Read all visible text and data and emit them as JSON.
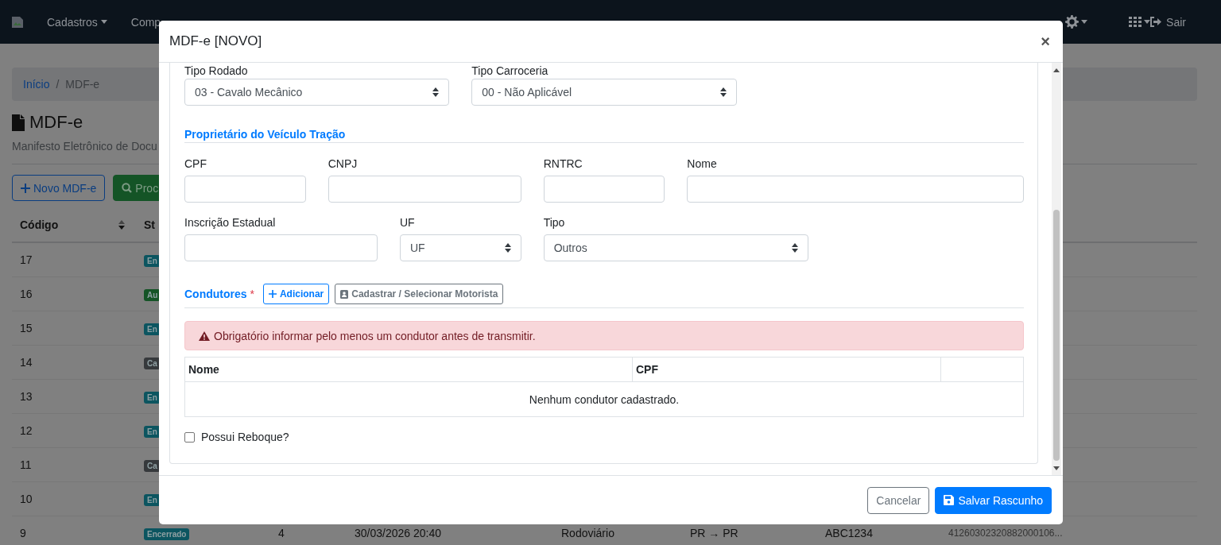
{
  "navbar": {
    "menu": [
      {
        "label": "Cadastros",
        "dropdown": true
      },
      {
        "label": "Comp",
        "dropdown": false
      }
    ],
    "logout": "Sair"
  },
  "breadcrumb": {
    "separator": "/",
    "items": [
      {
        "label": "Início",
        "kind": "link"
      },
      {
        "label": "MDF-e",
        "kind": "current"
      }
    ]
  },
  "page": {
    "title": "MDF-e",
    "subtitle": "Manifesto Eletrônico de Docu"
  },
  "actions": [
    {
      "label": "Novo MDF-e",
      "kind": "new"
    },
    {
      "label": "Proc",
      "kind": "search"
    }
  ],
  "table": {
    "columns": [
      "Código",
      "St"
    ],
    "rows": [
      {
        "code": "17",
        "status": {
          "label": "En",
          "color": "#0c5560"
        }
      },
      {
        "code": "16",
        "status": {
          "label": "Au",
          "color": "#145426"
        }
      },
      {
        "code": "15",
        "status": {
          "label": "En",
          "color": "#0c5560"
        }
      },
      {
        "code": "14",
        "status": {
          "label": "Ca",
          "color": "#36393c"
        }
      },
      {
        "code": "13",
        "status": {
          "label": "En",
          "color": "#0c5560"
        }
      },
      {
        "code": "12",
        "status": {
          "label": "En",
          "color": "#0c5560"
        }
      },
      {
        "code": "11",
        "status": {
          "label": "Ca",
          "color": "#36393c"
        }
      },
      {
        "code": "10",
        "status": {
          "label": "En",
          "color": "#0c5560"
        }
      },
      {
        "code": "9",
        "status": {
          "label": "Encerrado",
          "color": "#0c5560"
        },
        "cells": [
          "4",
          "30/03/2026 20:40",
          "Rodoviário",
          "PR → PR",
          "ABC1234",
          "41260302320882000106..."
        ]
      }
    ]
  },
  "modal": {
    "title": "MDF-e [NOVO]",
    "close": "×",
    "vehicle_fields": [
      {
        "kind": "select",
        "label": "Tipo Rodado",
        "value": "03 - Cavalo Mecânico"
      },
      {
        "kind": "select",
        "label": "Tipo Carroceria",
        "value": "00 - Não Aplicável"
      }
    ],
    "owner": {
      "heading": "Proprietário do Veículo Tração",
      "fields": [
        {
          "kind": "text",
          "label": "CPF"
        },
        {
          "kind": "text",
          "label": "CNPJ"
        },
        {
          "kind": "text",
          "label": "RNTRC"
        },
        {
          "kind": "text",
          "label": "Nome"
        },
        {
          "kind": "text",
          "label": "Inscrição Estadual"
        },
        {
          "kind": "select",
          "label": "UF",
          "value": "UF"
        },
        {
          "kind": "select",
          "label": "Tipo",
          "value": "Outros"
        }
      ]
    },
    "drivers": {
      "heading": "Condutores",
      "required_mark": "*",
      "buttons": [
        {
          "label": "Adicionar",
          "kind": "add"
        },
        {
          "label": "Cadastrar / Selecionar Motorista",
          "kind": "register"
        }
      ],
      "alert": "Obrigatório informar pelo menos um condutor antes de transmitir.",
      "columns": [
        "Nome",
        "CPF"
      ],
      "empty_message": "Nenhum condutor cadastrado."
    },
    "trailer": {
      "label": "Possui Reboque?",
      "checked": false
    },
    "footer_buttons": [
      {
        "label": "Cancelar",
        "kind": "secondary"
      },
      {
        "label": "Salvar Rascunho",
        "kind": "primary"
      }
    ]
  }
}
